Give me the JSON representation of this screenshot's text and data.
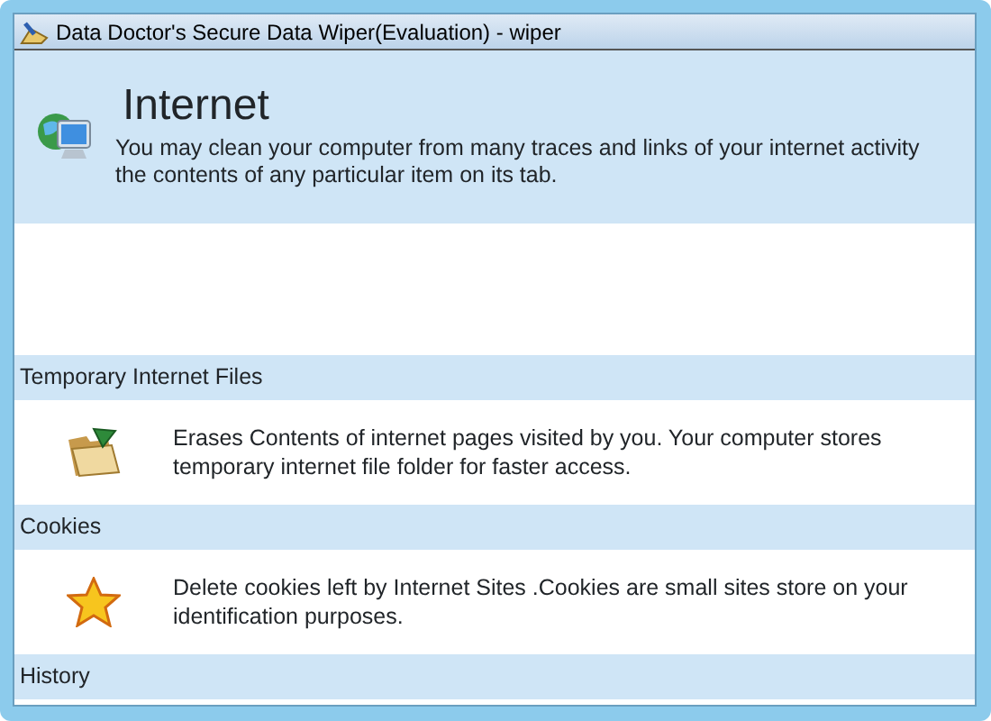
{
  "window": {
    "title": "Data Doctor's Secure Data Wiper(Evaluation) - wiper"
  },
  "header": {
    "title": "Internet",
    "description": "You may clean your computer from many traces and links of your internet activity the contents of any particular item on its tab."
  },
  "sections": [
    {
      "title": "Temporary Internet Files",
      "description": "Erases Contents of internet pages visited by you. Your computer stores temporary internet file folder for faster access."
    },
    {
      "title": "Cookies",
      "description": "Delete cookies left by Internet Sites .Cookies are small sites store on your identification purposes."
    },
    {
      "title": "History"
    }
  ]
}
